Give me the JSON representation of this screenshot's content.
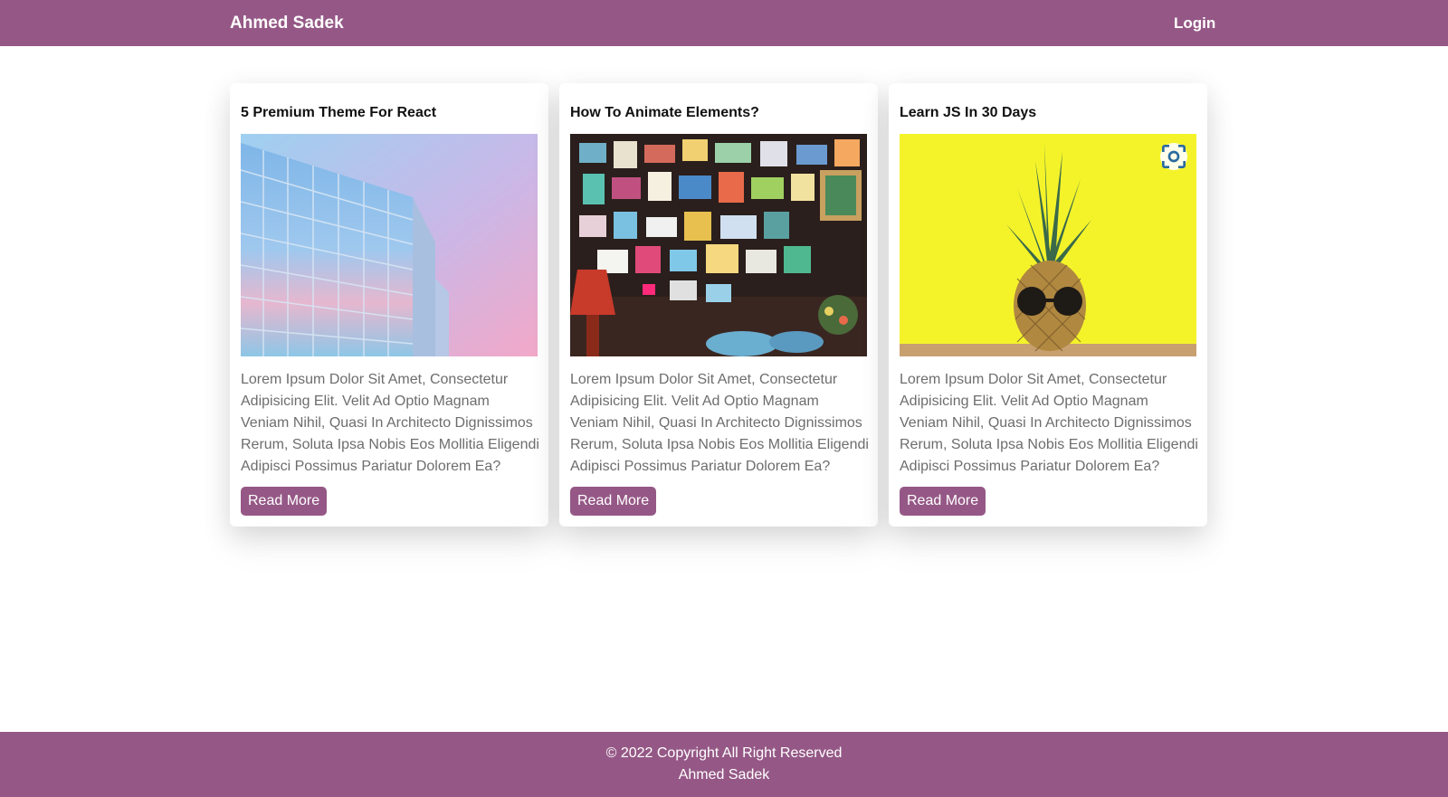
{
  "header": {
    "brand": "Ahmed Sadek",
    "login_label": "Login",
    "background_color": "#955886"
  },
  "cards": [
    {
      "title": "5 Premium Theme For React",
      "image_description_icon": "building-photo",
      "body": "Lorem Ipsum Dolor Sit Amet, Consectetur Adipisicing Elit. Velit Ad Optio Magnam Veniam Nihil, Quasi In Architecto Dignissimos Rerum, Soluta Ipsa Nobis Eos Mollitia Eligendi Adipisci Possimus Pariatur Dolorem Ea?",
      "button_label": "Read More"
    },
    {
      "title": "How To Animate Elements?",
      "image_description_icon": "poster-wall-photo",
      "body": "Lorem Ipsum Dolor Sit Amet, Consectetur Adipisicing Elit. Velit Ad Optio Magnam Veniam Nihil, Quasi In Architecto Dignissimos Rerum, Soluta Ipsa Nobis Eos Mollitia Eligendi Adipisci Possimus Pariatur Dolorem Ea?",
      "button_label": "Read More"
    },
    {
      "title": "Learn JS In 30 Days",
      "image_description_icon": "pineapple-photo",
      "body": "Lorem Ipsum Dolor Sit Amet, Consectetur Adipisicing Elit. Velit Ad Optio Magnam Veniam Nihil, Quasi In Architecto Dignissimos Rerum, Soluta Ipsa Nobis Eos Mollitia Eligendi Adipisci Possimus Pariatur Dolorem Ea?",
      "button_label": "Read More"
    }
  ],
  "footer": {
    "copyright": "© 2022 Copyright All Right Reserved",
    "name": "Ahmed Sadek"
  }
}
